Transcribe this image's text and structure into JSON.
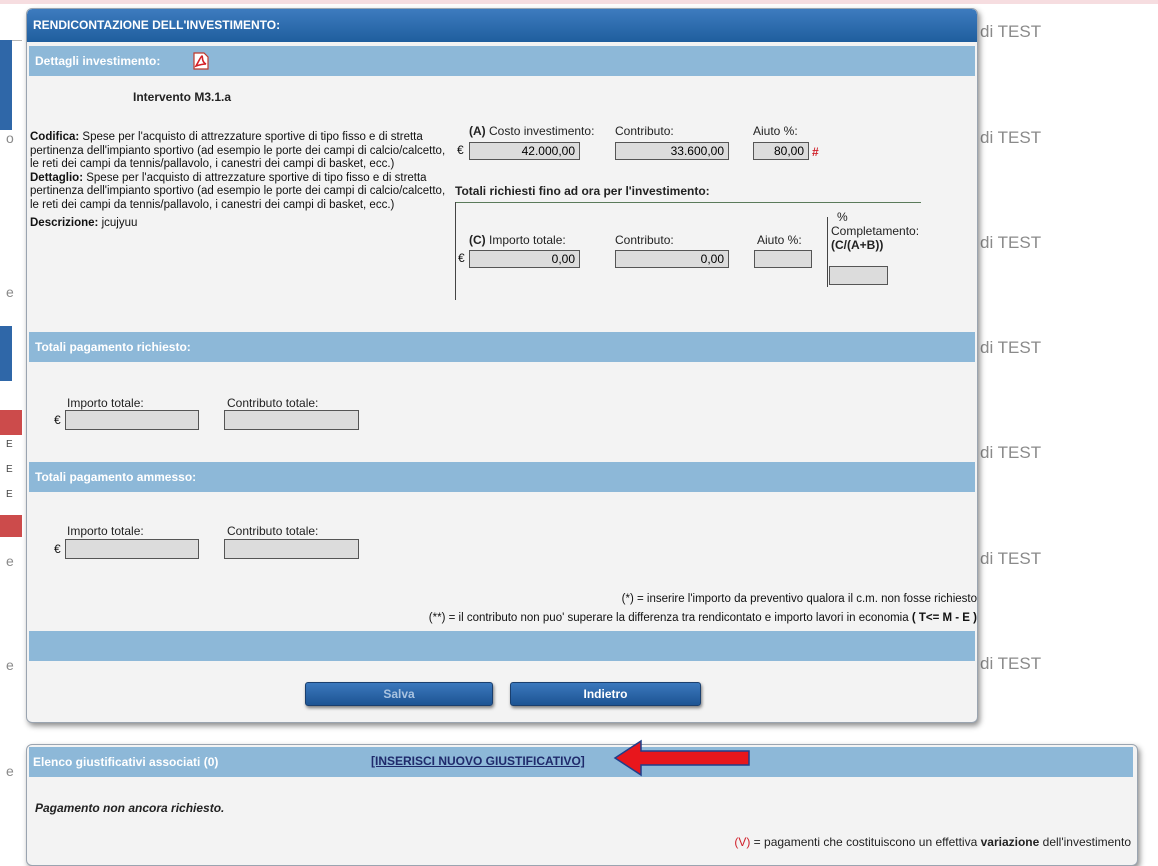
{
  "background": {
    "test_label": "di TEST",
    "left_letters": [
      "E",
      "E",
      "E"
    ],
    "fragments": [
      "o",
      "e",
      "e",
      "e",
      "e"
    ]
  },
  "modal": {
    "title": "RENDICONTAZIONE DELL'INVESTIMENTO:",
    "details_section": {
      "title": "Dettagli investimento:",
      "pdf_icon": "pdf-icon",
      "intervention": "Intervento M3.1.a",
      "codifica_label": "Codifica:",
      "codifica_text": "Spese per l'acquisto di attrezzature sportive di tipo fisso e di stretta pertinenza dell'impianto sportivo (ad esempio le porte dei campi di calcio/calcetto, le reti dei campi da tennis/pallavolo, i canestri dei campi di basket, ecc.)",
      "dettaglio_label": "Dettaglio:",
      "dettaglio_text": "Spese per l'acquisto di attrezzature sportive di tipo fisso e di stretta pertinenza dell'impianto sportivo (ad esempio le porte dei campi di calcio/calcetto, le reti dei campi da tennis/pallavolo, i canestri dei campi di basket, ecc.)",
      "descrizione_label": "Descrizione:",
      "descrizione_text": "jcujyuu"
    },
    "investment": {
      "cost_prefix": "(A)",
      "cost_label": "Costo investimento:",
      "contributo_label": "Contributo:",
      "aiuto_label": "Aiuto %:",
      "currency": "€",
      "cost_value": "42.000,00",
      "contributo_value": "33.600,00",
      "aiuto_value": "80,00",
      "hash_mark": "#"
    },
    "totals_requested": {
      "heading": "Totali richiesti fino ad ora per l'investimento:",
      "importo_prefix": "(C)",
      "importo_label": "Importo totale:",
      "contributo_label": "Contributo:",
      "aiuto_label": "Aiuto %:",
      "completamento_pct": "%",
      "completamento_label": "Completamento:",
      "completamento_formula": "(C/(A+B))",
      "importo_value": "0,00",
      "contributo_value": "0,00",
      "aiuto_value": "",
      "completamento_value": ""
    },
    "payment_requested": {
      "title": "Totali pagamento richiesto:",
      "importo_label": "Importo totale:",
      "contributo_label": "Contributo totale:",
      "importo_value": "",
      "contributo_value": ""
    },
    "payment_admitted": {
      "title": "Totali pagamento ammesso:",
      "importo_label": "Importo totale:",
      "contributo_label": "Contributo totale:",
      "importo_value": "",
      "contributo_value": ""
    },
    "notes": {
      "note1": "(*) = inserire l'importo da preventivo qualora il c.m. non fosse richiesto",
      "note2": "(**) = il contributo non puo' superare la differenza tra rendicontato e importo lavori in economia",
      "note2_formula": "( T<= M - E )"
    },
    "buttons": {
      "save": "Salva",
      "back": "Indietro"
    }
  },
  "justifications": {
    "title": "Elenco giustificativi associati (0)",
    "insert_link": "[INSERISCI NUOVO GIUSTIFICATIVO]",
    "status": "Pagamento non ancora richiesto.",
    "legend_code": "(V)",
    "legend_text": "= pagamenti che costituiscono un effettiva",
    "legend_bold": "variazione",
    "legend_tail": "dell'investimento"
  },
  "colors": {
    "header_blue": "#1f5e9e",
    "section_blue": "#8db8d8",
    "warning_red": "#d0202a",
    "arrow_red": "#e8161c"
  }
}
